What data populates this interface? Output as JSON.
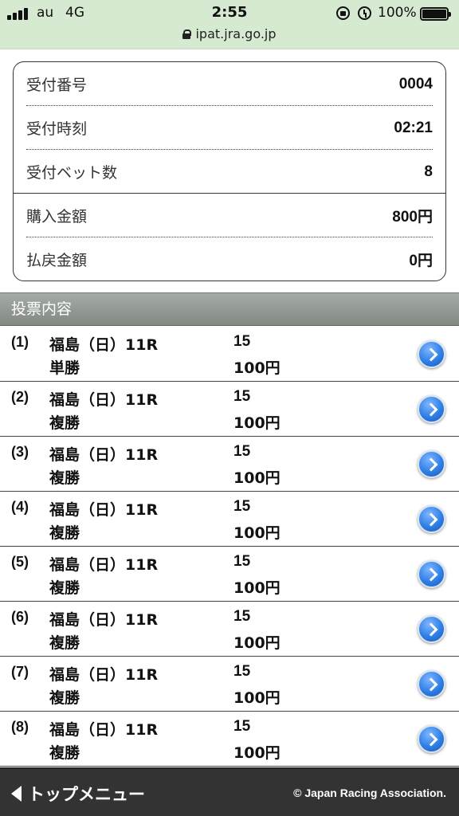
{
  "status_bar": {
    "carrier": "au",
    "network": "4G",
    "time": "2:55",
    "battery": "100%",
    "url": "ipat.jra.go.jp"
  },
  "summary": {
    "receipt_number": {
      "label": "受付番号",
      "value": "0004"
    },
    "receipt_time": {
      "label": "受付時刻",
      "value": "02:21"
    },
    "bet_count": {
      "label": "受付ベット数",
      "value": "8"
    },
    "purchase_amount": {
      "label": "購入金額",
      "value": "800円"
    },
    "payout_amount": {
      "label": "払戻金額",
      "value": "0円"
    }
  },
  "section": {
    "title": "投票内容"
  },
  "bets": [
    {
      "num": "(1)",
      "race": "福島（日）11R",
      "type": "単勝",
      "horse": "15",
      "amount": "100円"
    },
    {
      "num": "(2)",
      "race": "福島（日）11R",
      "type": "複勝",
      "horse": "15",
      "amount": "100円"
    },
    {
      "num": "(3)",
      "race": "福島（日）11R",
      "type": "複勝",
      "horse": "15",
      "amount": "100円"
    },
    {
      "num": "(4)",
      "race": "福島（日）11R",
      "type": "複勝",
      "horse": "15",
      "amount": "100円"
    },
    {
      "num": "(5)",
      "race": "福島（日）11R",
      "type": "複勝",
      "horse": "15",
      "amount": "100円"
    },
    {
      "num": "(6)",
      "race": "福島（日）11R",
      "type": "複勝",
      "horse": "15",
      "amount": "100円"
    },
    {
      "num": "(7)",
      "race": "福島（日）11R",
      "type": "複勝",
      "horse": "15",
      "amount": "100円"
    },
    {
      "num": "(8)",
      "race": "福島（日）11R",
      "type": "複勝",
      "horse": "15",
      "amount": "100円"
    }
  ],
  "footer": {
    "back_label": "トップメニュー",
    "copyright": "© Japan Racing Association."
  },
  "colors": {
    "status_bar_bg": "#d6ead2",
    "section_header_bg": "#8f958f",
    "footer_bg": "#333333",
    "arrow_button": "#2f7fe6"
  }
}
